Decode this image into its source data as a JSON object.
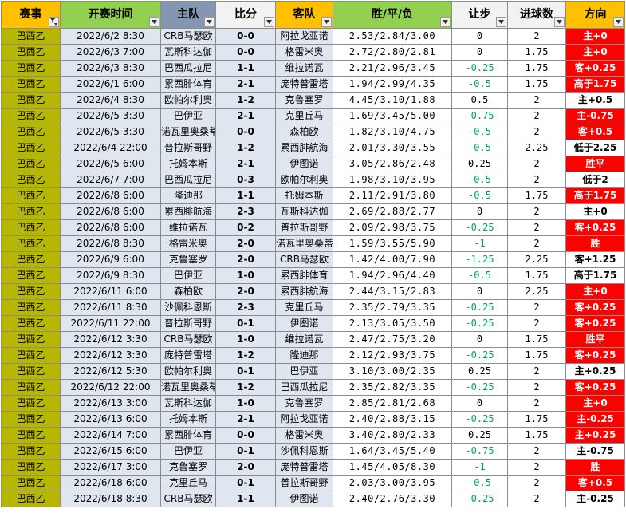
{
  "headers": {
    "league": "赛事",
    "time": "开赛时间",
    "home": "主队",
    "score": "比分",
    "away": "客队",
    "odds": "胜/平/负",
    "handicap": "让步",
    "goals": "进球数",
    "direction": "方向"
  },
  "colors": {
    "league_cell": "#b7b700",
    "result_red": "#ff0000",
    "negative_handicap_text": "#00a651",
    "header_orange": "#ffc000",
    "header_green": "#92d050",
    "header_blue": "#8497b0"
  },
  "rows": [
    {
      "league": "巴西乙",
      "time": "2022/6/2 8:30",
      "home": "CRB马瑟欧",
      "score": "0-0",
      "away": "阿拉戈亚诺",
      "odds": "2.53/2.84/3.00",
      "handicap": "0",
      "goals": "2",
      "direction": "主+0",
      "dir_color": "red"
    },
    {
      "league": "巴西乙",
      "time": "2022/6/3 7:00",
      "home": "瓦斯科达伽",
      "score": "0-0",
      "away": "格雷米奥",
      "odds": "2.72/2.80/2.81",
      "handicap": "0",
      "goals": "1.75",
      "direction": "主+0",
      "dir_color": "red"
    },
    {
      "league": "巴西乙",
      "time": "2022/6/3 8:30",
      "home": "巴西瓜拉尼",
      "score": "1-1",
      "away": "维拉诺瓦",
      "odds": "2.21/2.96/3.45",
      "handicap": "-0.25",
      "goals": "1.75",
      "direction": "客+0.25",
      "dir_color": "red"
    },
    {
      "league": "巴西乙",
      "time": "2022/6/1 6:00",
      "home": "累西腓体育",
      "score": "2-1",
      "away": "庞特普雷塔",
      "odds": "1.94/2.99/4.35",
      "handicap": "-0.5",
      "goals": "1.75",
      "direction": "高于1.75",
      "dir_color": "red"
    },
    {
      "league": "巴西乙",
      "time": "2022/6/4 8:30",
      "home": "欧帕尔利奥",
      "score": "1-2",
      "away": "克鲁塞罗",
      "odds": "4.45/3.10/1.88",
      "handicap": "0.5",
      "goals": "2",
      "direction": "主+0.5",
      "dir_color": "white"
    },
    {
      "league": "巴西乙",
      "time": "2022/6/5 3:30",
      "home": "巴伊亚",
      "score": "2-1",
      "away": "克里丘马",
      "odds": "1.69/3.45/5.00",
      "handicap": "-0.75",
      "goals": "2",
      "direction": "主-0.75",
      "dir_color": "red"
    },
    {
      "league": "巴西乙",
      "time": "2022/6/5 3:30",
      "home": "诺瓦里奥桑蒂",
      "score": "0-0",
      "away": "森柏欧",
      "odds": "1.82/3.10/4.75",
      "handicap": "-0.5",
      "goals": "2",
      "direction": "客+0.5",
      "dir_color": "red"
    },
    {
      "league": "巴西乙",
      "time": "2022/6/4 22:00",
      "home": "普拉斯哥野",
      "score": "1-2",
      "away": "累西腓航海",
      "odds": "2.01/3.30/3.55",
      "handicap": "-0.5",
      "goals": "2.25",
      "direction": "低于2.25",
      "dir_color": "white"
    },
    {
      "league": "巴西乙",
      "time": "2022/6/5 6:00",
      "home": "托姆本斯",
      "score": "2-1",
      "away": "伊图诺",
      "odds": "3.05/2.86/2.48",
      "handicap": "0.25",
      "goals": "2",
      "direction": "胜平",
      "dir_color": "red"
    },
    {
      "league": "巴西乙",
      "time": "2022/6/7 7:00",
      "home": "巴西瓜拉尼",
      "score": "0-3",
      "away": "欧帕尔利奥",
      "odds": "1.98/3.10/3.95",
      "handicap": "-0.5",
      "goals": "2",
      "direction": "低于2",
      "dir_color": "white"
    },
    {
      "league": "巴西乙",
      "time": "2022/6/8 6:00",
      "home": "隆迪那",
      "score": "1-1",
      "away": "托姆本斯",
      "odds": "2.11/2.91/3.80",
      "handicap": "-0.5",
      "goals": "1.75",
      "direction": "高于1.75",
      "dir_color": "red"
    },
    {
      "league": "巴西乙",
      "time": "2022/6/8 6:00",
      "home": "累西腓航海",
      "score": "2-3",
      "away": "瓦斯科达伽",
      "odds": "2.69/2.88/2.77",
      "handicap": "0",
      "goals": "2",
      "direction": "主+0",
      "dir_color": "white"
    },
    {
      "league": "巴西乙",
      "time": "2022/6/8 6:00",
      "home": "维拉诺瓦",
      "score": "0-2",
      "away": "普拉斯哥野",
      "odds": "2.09/2.98/3.75",
      "handicap": "-0.25",
      "goals": "2",
      "direction": "客+0.25",
      "dir_color": "red"
    },
    {
      "league": "巴西乙",
      "time": "2022/6/8 8:30",
      "home": "格雷米奥",
      "score": "2-0",
      "away": "诺瓦里奥桑蒂",
      "odds": "1.59/3.55/5.90",
      "handicap": "-1",
      "goals": "2",
      "direction": "胜",
      "dir_color": "red"
    },
    {
      "league": "巴西乙",
      "time": "2022/6/9 6:00",
      "home": "克鲁塞罗",
      "score": "2-0",
      "away": "CRB马瑟欧",
      "odds": "1.42/4.00/7.90",
      "handicap": "-1.25",
      "goals": "2.25",
      "direction": "客+1.25",
      "dir_color": "white"
    },
    {
      "league": "巴西乙",
      "time": "2022/6/9 8:30",
      "home": "巴伊亚",
      "score": "1-0",
      "away": "累西腓体育",
      "odds": "1.94/2.96/4.40",
      "handicap": "-0.5",
      "goals": "1.75",
      "direction": "高于1.75",
      "dir_color": "white"
    },
    {
      "league": "巴西乙",
      "time": "2022/6/11 6:00",
      "home": "森柏欧",
      "score": "2-0",
      "away": "累西腓航海",
      "odds": "2.44/3.15/2.83",
      "handicap": "0",
      "goals": "2.25",
      "direction": "主+0",
      "dir_color": "red"
    },
    {
      "league": "巴西乙",
      "time": "2022/6/11 8:30",
      "home": "沙佩科恩斯",
      "score": "2-3",
      "away": "克里丘马",
      "odds": "2.35/2.79/3.35",
      "handicap": "-0.25",
      "goals": "2",
      "direction": "客+0.25",
      "dir_color": "red"
    },
    {
      "league": "巴西乙",
      "time": "2022/6/11 22:00",
      "home": "普拉斯哥野",
      "score": "0-1",
      "away": "伊图诺",
      "odds": "2.13/3.05/3.50",
      "handicap": "-0.25",
      "goals": "2",
      "direction": "客+0.25",
      "dir_color": "red"
    },
    {
      "league": "巴西乙",
      "time": "2022/6/12 3:30",
      "home": "CRB马瑟欧",
      "score": "1-0",
      "away": "维拉诺瓦",
      "odds": "2.47/2.75/3.20",
      "handicap": "0",
      "goals": "1.75",
      "direction": "胜平",
      "dir_color": "red"
    },
    {
      "league": "巴西乙",
      "time": "2022/6/12 3:30",
      "home": "庞特普雷塔",
      "score": "1-2",
      "away": "隆迪那",
      "odds": "2.12/2.93/3.75",
      "handicap": "-0.25",
      "goals": "1.75",
      "direction": "客+0.25",
      "dir_color": "red"
    },
    {
      "league": "巴西乙",
      "time": "2022/6/12 5:30",
      "home": "欧帕尔利奥",
      "score": "0-1",
      "away": "巴伊亚",
      "odds": "3.10/3.00/2.35",
      "handicap": "0.25",
      "goals": "2",
      "direction": "主+0.25",
      "dir_color": "white"
    },
    {
      "league": "巴西乙",
      "time": "2022/6/12 22:00",
      "home": "诺瓦里奥桑蒂",
      "score": "1-2",
      "away": "巴西瓜拉尼",
      "odds": "2.35/2.82/3.35",
      "handicap": "-0.25",
      "goals": "2",
      "direction": "客+0.25",
      "dir_color": "red"
    },
    {
      "league": "巴西乙",
      "time": "2022/6/13 3:00",
      "home": "瓦斯科达伽",
      "score": "1-0",
      "away": "克鲁塞罗",
      "odds": "2.85/2.81/2.68",
      "handicap": "0",
      "goals": "2",
      "direction": "主+0",
      "dir_color": "red"
    },
    {
      "league": "巴西乙",
      "time": "2022/6/13 6:00",
      "home": "托姆本斯",
      "score": "2-1",
      "away": "阿拉戈亚诺",
      "odds": "2.40/2.88/3.15",
      "handicap": "-0.25",
      "goals": "1.75",
      "direction": "主-0.25",
      "dir_color": "red"
    },
    {
      "league": "巴西乙",
      "time": "2022/6/14 7:00",
      "home": "累西腓体育",
      "score": "0-0",
      "away": "格雷米奥",
      "odds": "3.40/2.80/2.33",
      "handicap": "0.25",
      "goals": "1.75",
      "direction": "主+0.25",
      "dir_color": "red"
    },
    {
      "league": "巴西乙",
      "time": "2022/6/15 6:00",
      "home": "巴伊亚",
      "score": "0-1",
      "away": "沙佩科恩斯",
      "odds": "1.64/3.45/5.40",
      "handicap": "-0.75",
      "goals": "2",
      "direction": "主-0.75",
      "dir_color": "white"
    },
    {
      "league": "巴西乙",
      "time": "2022/6/17 3:00",
      "home": "克鲁塞罗",
      "score": "2-0",
      "away": "庞特普雷塔",
      "odds": "1.45/4.05/8.30",
      "handicap": "-1",
      "goals": "2",
      "direction": "胜",
      "dir_color": "red"
    },
    {
      "league": "巴西乙",
      "time": "2022/6/18 6:00",
      "home": "克里丘马",
      "score": "0-1",
      "away": "普拉斯哥野",
      "odds": "2.03/3.00/3.95",
      "handicap": "-0.5",
      "goals": "2",
      "direction": "客+0.5",
      "dir_color": "red"
    },
    {
      "league": "巴西乙",
      "time": "2022/6/18 8:30",
      "home": "CRB马瑟欧",
      "score": "1-1",
      "away": "伊图诺",
      "odds": "2.40/2.76/3.30",
      "handicap": "-0.25",
      "goals": "2",
      "direction": "主-0.25",
      "dir_color": "white"
    }
  ]
}
